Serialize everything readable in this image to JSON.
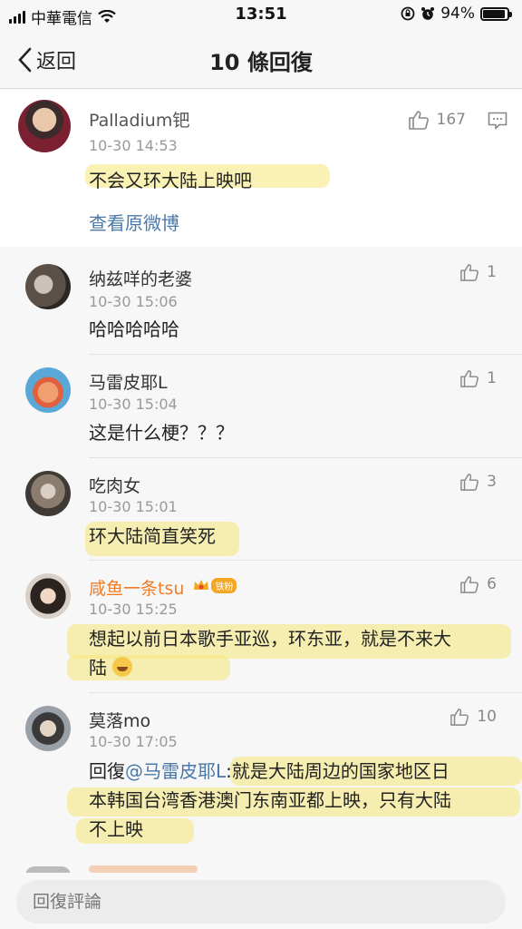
{
  "status_bar": {
    "carrier": "中華電信",
    "time": "13:51",
    "battery": "94%",
    "battery_level": 0.94
  },
  "nav": {
    "back_label": "返回",
    "title": "10 條回復"
  },
  "main_post": {
    "author": "Palladium钯",
    "time": "10-30 14:53",
    "text": "不会又环大陆上映吧",
    "likes": "167",
    "view_original": "查看原微博"
  },
  "comments": [
    {
      "author": "纳兹咩的老婆",
      "time": "10-30 15:06",
      "text": "哈哈哈哈哈",
      "likes": "1"
    },
    {
      "author": "马雷皮耶L",
      "time": "10-30 15:04",
      "text": "这是什么梗？？？",
      "likes": "1"
    },
    {
      "author": "吃肉女",
      "time": "10-30 15:01",
      "text": "环大陆简直笑死",
      "likes": "3"
    },
    {
      "author": "咸鱼一条tsu",
      "badge": "铁粉",
      "time": "10-30 15:25",
      "text_line1": "想起以前日本歌手亚巡，环东亚，就是不来大",
      "text_line2": "陆",
      "likes": "6"
    },
    {
      "author": "莫落mo",
      "time": "10-30 17:05",
      "reply_prefix": "回復",
      "mention": "@马雷皮耶L",
      "text_line1": ":就是大陆周边的国家地区日",
      "text_line2": "本韩国台湾香港澳门东南亚都上映，只有大陆",
      "text_line3": "不上映",
      "likes": "10"
    }
  ],
  "reply_bar": {
    "placeholder": "回復評論"
  },
  "colors": {
    "link": "#4a78a8",
    "vip_name": "#f07c28",
    "highlight": "#f5e878"
  }
}
